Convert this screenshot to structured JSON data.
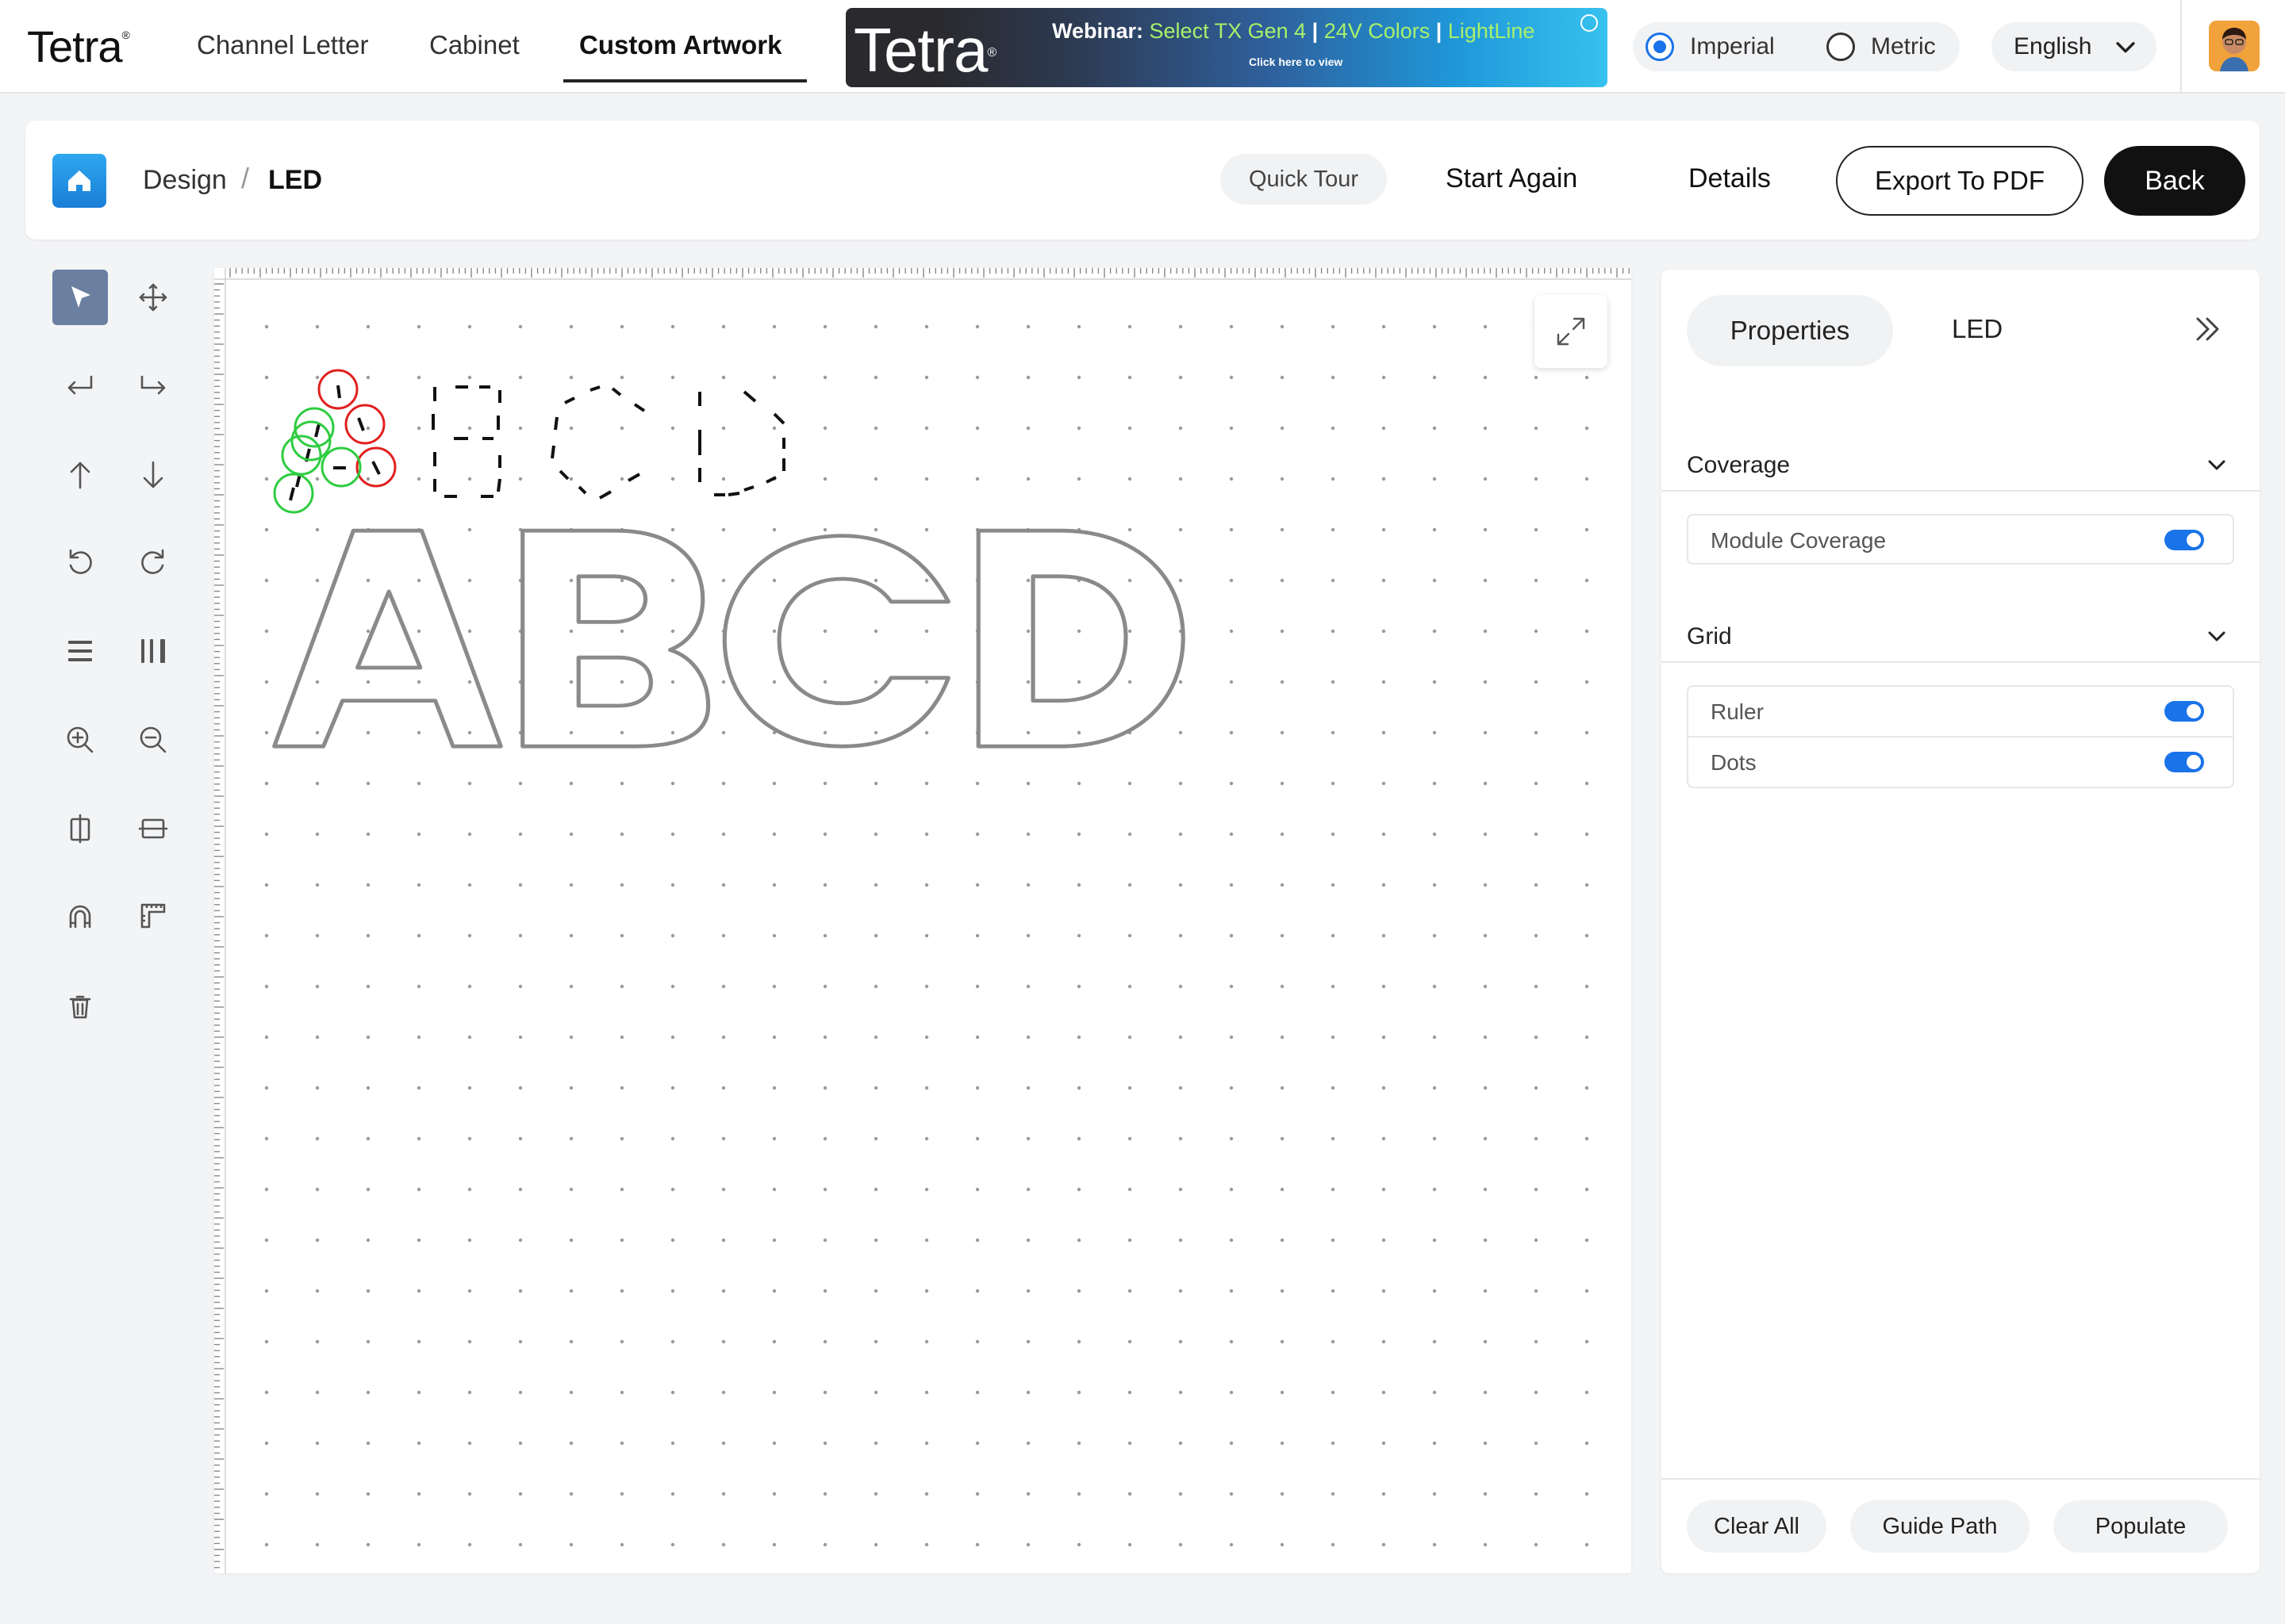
{
  "brand": {
    "logo": "Tetra",
    "accent": "#1a73e8"
  },
  "nav": {
    "items": [
      {
        "label": "Channel Letter"
      },
      {
        "label": "Cabinet"
      },
      {
        "label": "Custom Artwork",
        "active": true
      }
    ]
  },
  "banner": {
    "logo": "Tetra",
    "prefix": "Webinar:",
    "part1": "Select TX Gen 4",
    "sep1": " | ",
    "part2": "24V Colors",
    "sep2": " | ",
    "part3": "LightLine",
    "sub": "Click here to view"
  },
  "units": {
    "imperial": "Imperial",
    "metric": "Metric",
    "selected": "Imperial"
  },
  "language": {
    "selected": "English"
  },
  "breadcrumb": {
    "root": "Design",
    "separator": "/",
    "current": "LED"
  },
  "header": {
    "quick_tour": "Quick Tour",
    "start_again": "Start Again",
    "details": "Details",
    "export_pdf": "Export To PDF",
    "back": "Back"
  },
  "toolbar": {
    "tools": [
      "select-icon",
      "move-icon",
      "undo-path-icon",
      "redo-path-icon",
      "arrow-up-icon",
      "arrow-down-icon",
      "rotate-left-icon",
      "rotate-right-icon",
      "align-horizontal-icon",
      "align-vertical-icon",
      "zoom-in-icon",
      "zoom-out-icon",
      "flip-vertical-icon",
      "flip-horizontal-icon",
      "magnet-icon",
      "ruler-icon",
      "trash-icon"
    ]
  },
  "canvas": {
    "artwork_text": "ABCD",
    "grid_dots": true,
    "ruler": true,
    "module_colors": {
      "valid": "#2ecc40",
      "invalid": "#e0201f"
    }
  },
  "panel": {
    "tabs": [
      {
        "label": "Properties",
        "active": true
      },
      {
        "label": "LED"
      }
    ],
    "coverage": {
      "title": "Coverage",
      "options": [
        {
          "label": "Module Coverage",
          "on": true
        }
      ]
    },
    "grid": {
      "title": "Grid",
      "options": [
        {
          "label": "Ruler",
          "on": true
        },
        {
          "label": "Dots",
          "on": true
        }
      ]
    },
    "actions": {
      "clear_all": "Clear All",
      "guide_path": "Guide Path",
      "populate": "Populate"
    }
  }
}
